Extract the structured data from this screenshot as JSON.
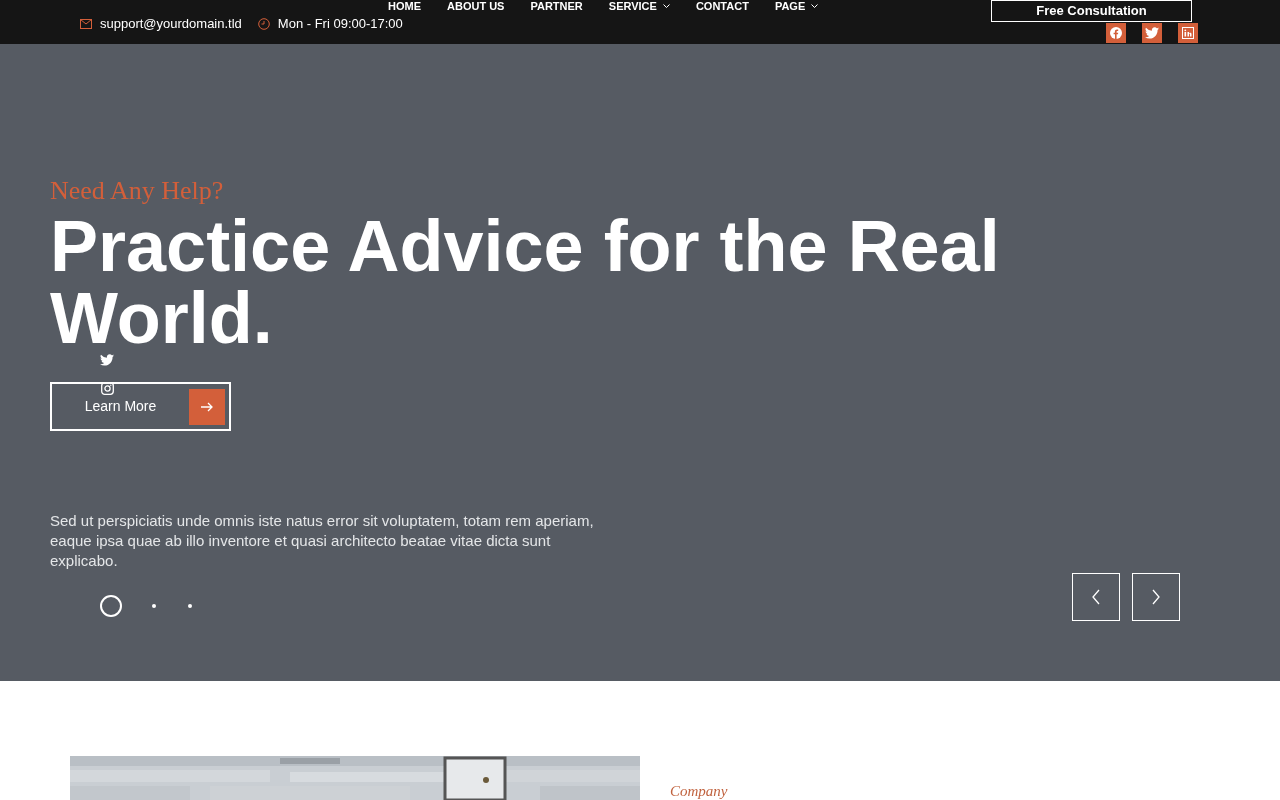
{
  "topbar": {
    "email": "support@yourdomain.tld",
    "hours": "Mon - Fri 09:00-17:00"
  },
  "nav": [
    {
      "label": "HOME",
      "dropdown": false
    },
    {
      "label": "ABOUT US",
      "dropdown": false
    },
    {
      "label": "PARTNER",
      "dropdown": false
    },
    {
      "label": "SERVICE",
      "dropdown": true
    },
    {
      "label": "CONTACT",
      "dropdown": false
    },
    {
      "label": "PAGE",
      "dropdown": true
    }
  ],
  "cta_button": "Free Consultation",
  "social_top": [
    {
      "kind": "facebook"
    },
    {
      "kind": "twitter"
    },
    {
      "kind": "linkedin"
    }
  ],
  "social_side": [
    {
      "kind": "twitter"
    },
    {
      "kind": "instagram"
    }
  ],
  "hero": {
    "kicker": "Need Any Help?",
    "title": "Practice Advice for the Real World.",
    "button": "Learn More",
    "text": "Sed ut perspiciatis unde omnis iste natus error sit voluptatem, totam rem aperiam, eaque ipsa quae ab illo inventore et quasi architecto beatae vitae dicta sunt explicabo.",
    "dots": [
      {
        "selected": true
      },
      {
        "selected": false
      },
      {
        "selected": false
      }
    ]
  },
  "about": {
    "kicker": "Company"
  }
}
